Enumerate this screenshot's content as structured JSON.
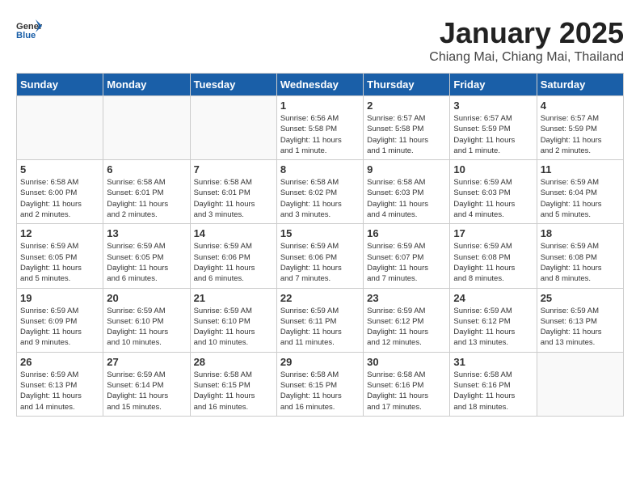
{
  "header": {
    "logo_general": "General",
    "logo_blue": "Blue",
    "title": "January 2025",
    "subtitle": "Chiang Mai, Chiang Mai, Thailand"
  },
  "weekdays": [
    "Sunday",
    "Monday",
    "Tuesday",
    "Wednesday",
    "Thursday",
    "Friday",
    "Saturday"
  ],
  "weeks": [
    [
      {
        "day": "",
        "info": ""
      },
      {
        "day": "",
        "info": ""
      },
      {
        "day": "",
        "info": ""
      },
      {
        "day": "1",
        "info": "Sunrise: 6:56 AM\nSunset: 5:58 PM\nDaylight: 11 hours\nand 1 minute."
      },
      {
        "day": "2",
        "info": "Sunrise: 6:57 AM\nSunset: 5:58 PM\nDaylight: 11 hours\nand 1 minute."
      },
      {
        "day": "3",
        "info": "Sunrise: 6:57 AM\nSunset: 5:59 PM\nDaylight: 11 hours\nand 1 minute."
      },
      {
        "day": "4",
        "info": "Sunrise: 6:57 AM\nSunset: 5:59 PM\nDaylight: 11 hours\nand 2 minutes."
      }
    ],
    [
      {
        "day": "5",
        "info": "Sunrise: 6:58 AM\nSunset: 6:00 PM\nDaylight: 11 hours\nand 2 minutes."
      },
      {
        "day": "6",
        "info": "Sunrise: 6:58 AM\nSunset: 6:01 PM\nDaylight: 11 hours\nand 2 minutes."
      },
      {
        "day": "7",
        "info": "Sunrise: 6:58 AM\nSunset: 6:01 PM\nDaylight: 11 hours\nand 3 minutes."
      },
      {
        "day": "8",
        "info": "Sunrise: 6:58 AM\nSunset: 6:02 PM\nDaylight: 11 hours\nand 3 minutes."
      },
      {
        "day": "9",
        "info": "Sunrise: 6:58 AM\nSunset: 6:03 PM\nDaylight: 11 hours\nand 4 minutes."
      },
      {
        "day": "10",
        "info": "Sunrise: 6:59 AM\nSunset: 6:03 PM\nDaylight: 11 hours\nand 4 minutes."
      },
      {
        "day": "11",
        "info": "Sunrise: 6:59 AM\nSunset: 6:04 PM\nDaylight: 11 hours\nand 5 minutes."
      }
    ],
    [
      {
        "day": "12",
        "info": "Sunrise: 6:59 AM\nSunset: 6:05 PM\nDaylight: 11 hours\nand 5 minutes."
      },
      {
        "day": "13",
        "info": "Sunrise: 6:59 AM\nSunset: 6:05 PM\nDaylight: 11 hours\nand 6 minutes."
      },
      {
        "day": "14",
        "info": "Sunrise: 6:59 AM\nSunset: 6:06 PM\nDaylight: 11 hours\nand 6 minutes."
      },
      {
        "day": "15",
        "info": "Sunrise: 6:59 AM\nSunset: 6:06 PM\nDaylight: 11 hours\nand 7 minutes."
      },
      {
        "day": "16",
        "info": "Sunrise: 6:59 AM\nSunset: 6:07 PM\nDaylight: 11 hours\nand 7 minutes."
      },
      {
        "day": "17",
        "info": "Sunrise: 6:59 AM\nSunset: 6:08 PM\nDaylight: 11 hours\nand 8 minutes."
      },
      {
        "day": "18",
        "info": "Sunrise: 6:59 AM\nSunset: 6:08 PM\nDaylight: 11 hours\nand 8 minutes."
      }
    ],
    [
      {
        "day": "19",
        "info": "Sunrise: 6:59 AM\nSunset: 6:09 PM\nDaylight: 11 hours\nand 9 minutes."
      },
      {
        "day": "20",
        "info": "Sunrise: 6:59 AM\nSunset: 6:10 PM\nDaylight: 11 hours\nand 10 minutes."
      },
      {
        "day": "21",
        "info": "Sunrise: 6:59 AM\nSunset: 6:10 PM\nDaylight: 11 hours\nand 10 minutes."
      },
      {
        "day": "22",
        "info": "Sunrise: 6:59 AM\nSunset: 6:11 PM\nDaylight: 11 hours\nand 11 minutes."
      },
      {
        "day": "23",
        "info": "Sunrise: 6:59 AM\nSunset: 6:12 PM\nDaylight: 11 hours\nand 12 minutes."
      },
      {
        "day": "24",
        "info": "Sunrise: 6:59 AM\nSunset: 6:12 PM\nDaylight: 11 hours\nand 13 minutes."
      },
      {
        "day": "25",
        "info": "Sunrise: 6:59 AM\nSunset: 6:13 PM\nDaylight: 11 hours\nand 13 minutes."
      }
    ],
    [
      {
        "day": "26",
        "info": "Sunrise: 6:59 AM\nSunset: 6:13 PM\nDaylight: 11 hours\nand 14 minutes."
      },
      {
        "day": "27",
        "info": "Sunrise: 6:59 AM\nSunset: 6:14 PM\nDaylight: 11 hours\nand 15 minutes."
      },
      {
        "day": "28",
        "info": "Sunrise: 6:58 AM\nSunset: 6:15 PM\nDaylight: 11 hours\nand 16 minutes."
      },
      {
        "day": "29",
        "info": "Sunrise: 6:58 AM\nSunset: 6:15 PM\nDaylight: 11 hours\nand 16 minutes."
      },
      {
        "day": "30",
        "info": "Sunrise: 6:58 AM\nSunset: 6:16 PM\nDaylight: 11 hours\nand 17 minutes."
      },
      {
        "day": "31",
        "info": "Sunrise: 6:58 AM\nSunset: 6:16 PM\nDaylight: 11 hours\nand 18 minutes."
      },
      {
        "day": "",
        "info": ""
      }
    ]
  ]
}
